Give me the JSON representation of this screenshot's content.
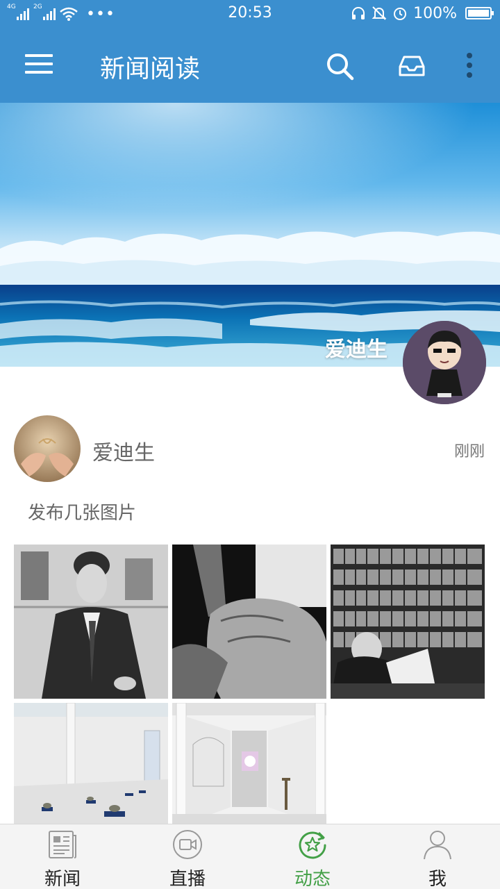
{
  "status_bar": {
    "network_1": "4G",
    "network_2": "2G",
    "time": "20:53",
    "battery": "100%"
  },
  "app_bar": {
    "title": "新闻阅读",
    "icons": [
      "menu-icon",
      "search-icon",
      "inbox-icon",
      "more-vertical-icon"
    ]
  },
  "cover": {
    "user_name": "爱迪生"
  },
  "post": {
    "author": "爱迪生",
    "time": "刚刚",
    "text": "发布几张图片",
    "photo_count": 5
  },
  "bottom_nav": {
    "items": [
      {
        "label": "新闻",
        "icon": "newspaper-icon",
        "active": false
      },
      {
        "label": "直播",
        "icon": "video-camera-icon",
        "active": false
      },
      {
        "label": "动态",
        "icon": "star-refresh-icon",
        "active": true
      },
      {
        "label": "我",
        "icon": "person-icon",
        "active": false
      }
    ]
  },
  "colors": {
    "primary": "#3b8fcf",
    "active_tab": "#43a047",
    "nav_background": "#f4f4f4"
  }
}
